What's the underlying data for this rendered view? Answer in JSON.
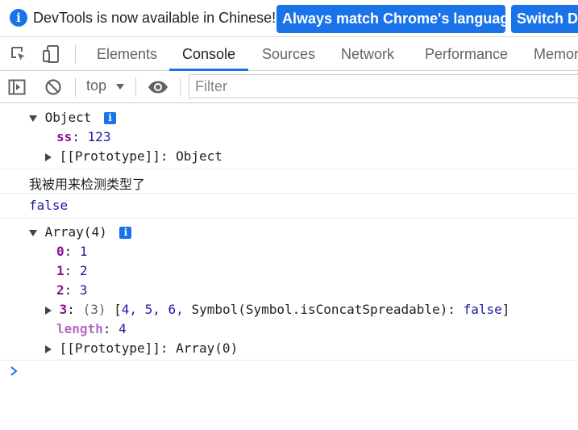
{
  "infobar": {
    "message": "DevTools is now available in Chinese!",
    "match_button": "Always match Chrome's language",
    "switch_button": "Switch De"
  },
  "tabs": [
    {
      "label": "Elements"
    },
    {
      "label": "Console"
    },
    {
      "label": "Sources"
    },
    {
      "label": "Network"
    },
    {
      "label": "Performance"
    },
    {
      "label": "Memor"
    }
  ],
  "active_tab": "Console",
  "toolbar": {
    "context": "top",
    "filter_placeholder": "Filter"
  },
  "console": {
    "obj_label": "Object",
    "obj_key": "ss",
    "colon": ":",
    "obj_value": "123",
    "proto_label": "[[Prototype]]: Object",
    "message_text": "我被用来检测类型了",
    "bool_value": "false",
    "array_label": "Array(4)",
    "array_items": [
      {
        "key": "0",
        "value": "1"
      },
      {
        "key": "1",
        "value": "2"
      },
      {
        "key": "2",
        "value": "3"
      }
    ],
    "nested_key": "3",
    "nested_count": "(3)",
    "nested_open": "[",
    "nested_nums": "4, 5, 6,",
    "nested_symbol": "Symbol(Symbol.isConcatSpreadable):",
    "nested_false": "false",
    "nested_close": "]",
    "length_key": "length",
    "length_value": "4",
    "array_proto": "[[Prototype]]: Array(0)"
  },
  "colors": {
    "accent": "#1a73e8",
    "key": "#881391",
    "number": "#1a1aa6"
  }
}
